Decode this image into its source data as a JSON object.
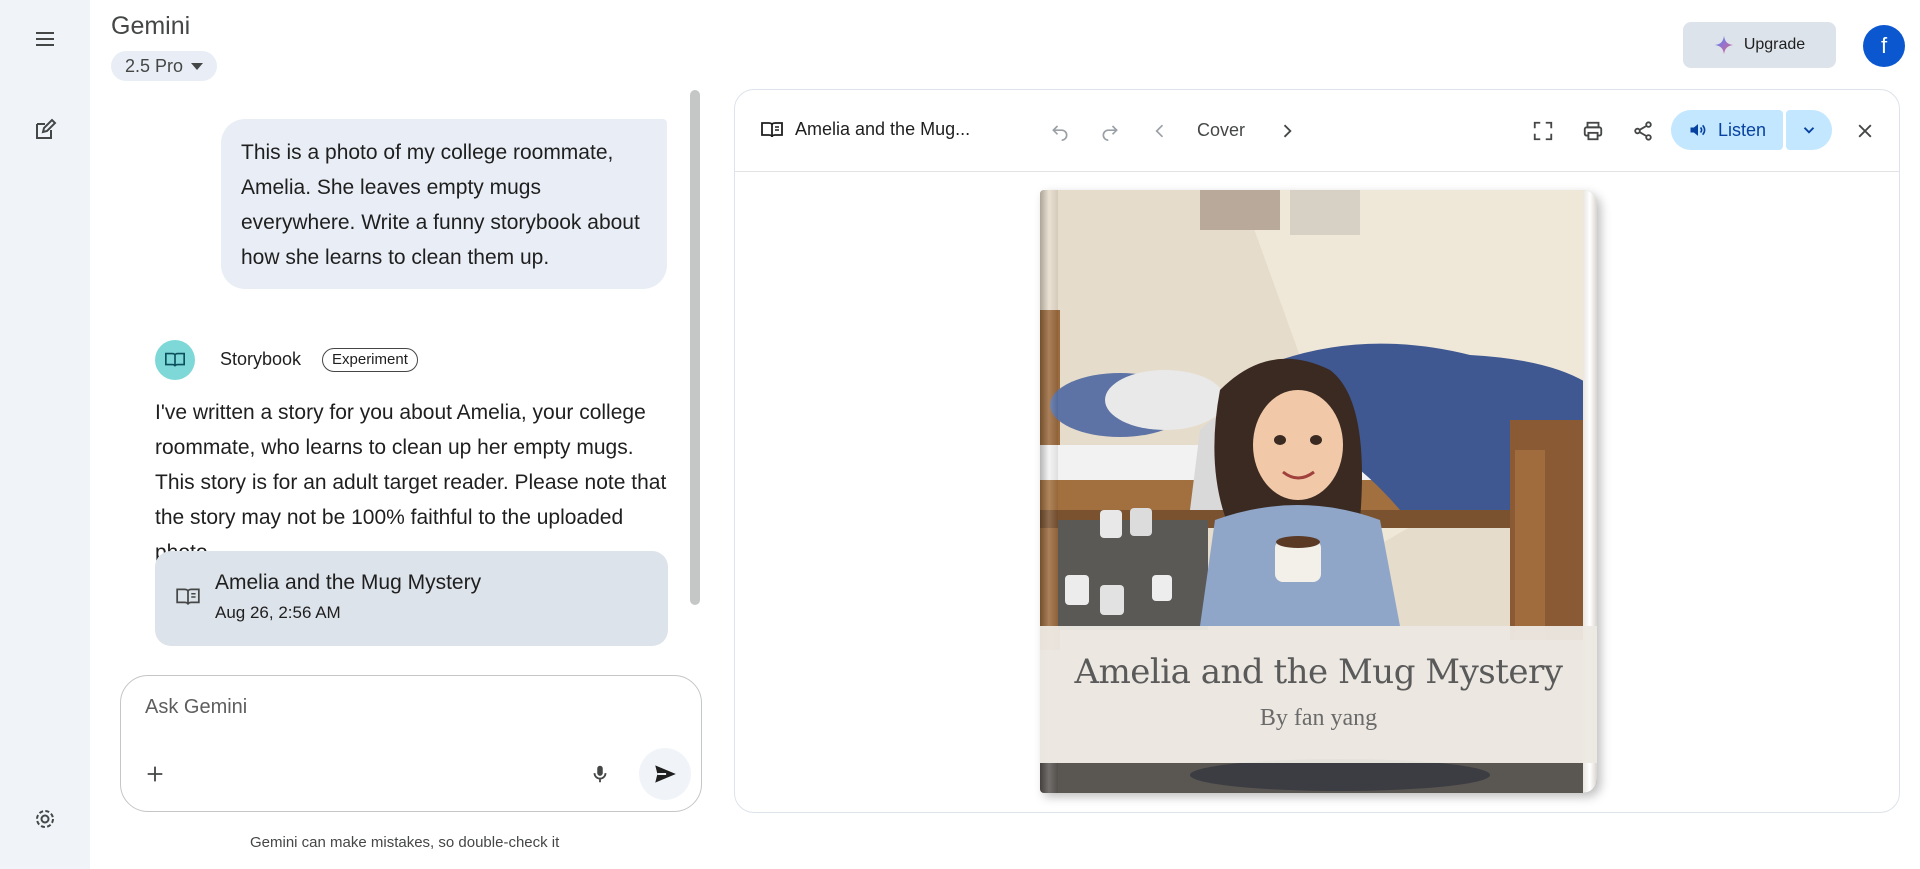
{
  "app": {
    "title": "Gemini",
    "model": "2.5 Pro"
  },
  "header": {
    "upgrade_label": "Upgrade",
    "avatar_letter": "f"
  },
  "chat": {
    "user_message": "This is a photo of my college roommate, Amelia. She leaves empty mugs everywhere. Write a funny storybook about how she learns to clean them up.",
    "bot_name": "Storybook",
    "bot_badge": "Experiment",
    "bot_message": "I've written a story for you about Amelia, your college roommate, who learns to clean up her empty mugs. This story is for an adult target reader. Please note that the story may not be 100% faithful to the uploaded photo.",
    "card": {
      "title": "Amelia and the Mug Mystery",
      "date": "Aug 26, 2:56 AM"
    }
  },
  "input": {
    "placeholder": "Ask Gemini"
  },
  "disclaimer": "Gemini can make mistakes, so double-check it",
  "panel": {
    "title": "Amelia and the Mug...",
    "page_label": "Cover",
    "listen_label": "Listen",
    "book_title": "Amelia and the Mug Mystery",
    "book_author": "By fan yang"
  },
  "colors": {
    "accent": "#0b57d0",
    "listen_bg": "#c2e7ff",
    "rail_bg": "#f0f4f9",
    "bubble_bg": "#e9eef6"
  },
  "icons": [
    "menu-icon",
    "new-chat-icon",
    "settings-icon",
    "sparkle-icon",
    "book-icon",
    "plus-icon",
    "mic-icon",
    "send-icon",
    "undo-icon",
    "redo-icon",
    "chevron-left-icon",
    "chevron-right-icon",
    "fullscreen-icon",
    "print-icon",
    "share-icon",
    "speaker-icon",
    "chevron-down-icon",
    "close-icon"
  ]
}
